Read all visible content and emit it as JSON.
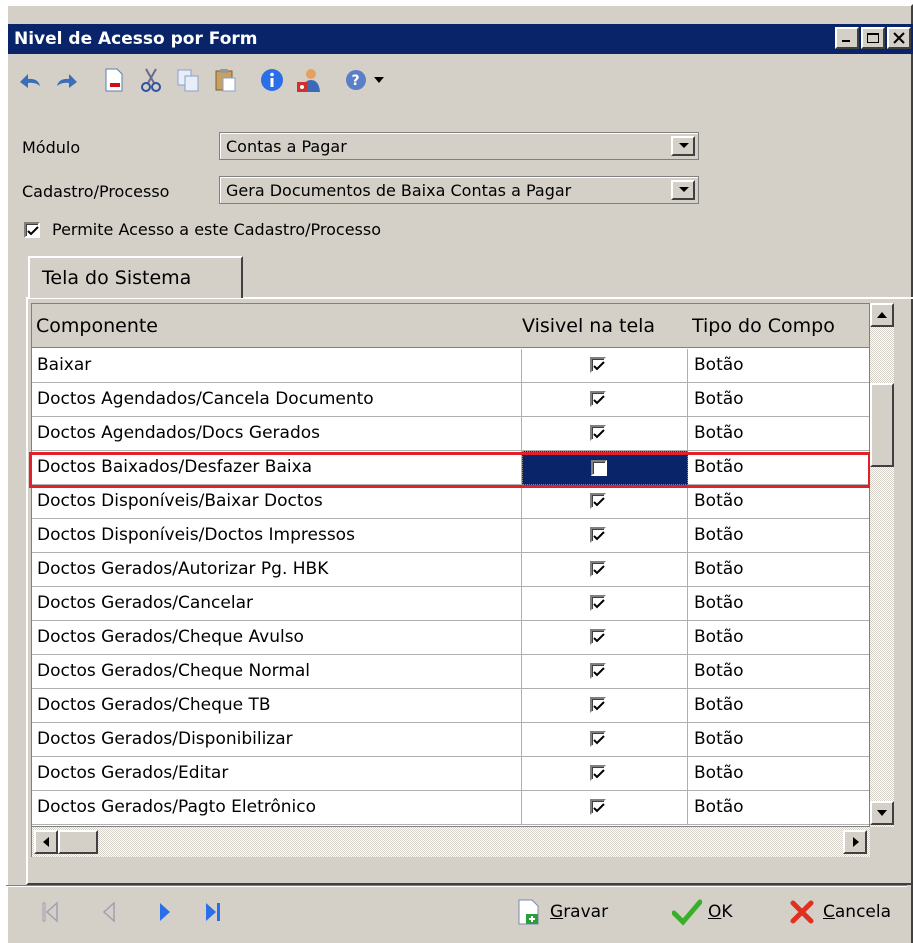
{
  "window": {
    "title": "Nivel de Acesso por Form"
  },
  "toolbar": {
    "items": [
      "undo-icon",
      "redo-icon",
      "new-document-icon",
      "cut-icon",
      "copy-icon",
      "paste-icon",
      "info-icon",
      "user-access-icon",
      "help-icon",
      "dropdown-arrow-icon"
    ]
  },
  "form": {
    "modulo_label": "Módulo",
    "modulo_value": "Contas a Pagar",
    "cadastro_label": "Cadastro/Processo",
    "cadastro_value": "Gera Documentos de Baixa Contas a Pagar",
    "permite_label": "Permite Acesso a este Cadastro/Processo",
    "permite_checked": true
  },
  "tab": {
    "label": "Tela do Sistema"
  },
  "grid": {
    "headers": {
      "componente": "Componente",
      "visivel": "Visivel na tela",
      "tipo": "Tipo do Compo"
    },
    "rows": [
      {
        "componente": "Baixar",
        "visivel": true,
        "tipo": "Botão"
      },
      {
        "componente": "Doctos Agendados/Cancela Documento",
        "visivel": true,
        "tipo": "Botão"
      },
      {
        "componente": "Doctos Agendados/Docs Gerados",
        "visivel": true,
        "tipo": "Botão"
      },
      {
        "componente": "Doctos Baixados/Desfazer Baixa",
        "visivel": false,
        "tipo": "Botão",
        "selected": true
      },
      {
        "componente": "Doctos Disponíveis/Baixar Doctos",
        "visivel": true,
        "tipo": "Botão"
      },
      {
        "componente": "Doctos Disponíveis/Doctos Impressos",
        "visivel": true,
        "tipo": "Botão"
      },
      {
        "componente": "Doctos Gerados/Autorizar Pg. HBK",
        "visivel": true,
        "tipo": "Botão"
      },
      {
        "componente": "Doctos Gerados/Cancelar",
        "visivel": true,
        "tipo": "Botão"
      },
      {
        "componente": "Doctos Gerados/Cheque Avulso",
        "visivel": true,
        "tipo": "Botão"
      },
      {
        "componente": "Doctos Gerados/Cheque Normal",
        "visivel": true,
        "tipo": "Botão"
      },
      {
        "componente": "Doctos Gerados/Cheque TB",
        "visivel": true,
        "tipo": "Botão"
      },
      {
        "componente": "Doctos Gerados/Disponibilizar",
        "visivel": true,
        "tipo": "Botão"
      },
      {
        "componente": "Doctos Gerados/Editar",
        "visivel": true,
        "tipo": "Botão"
      },
      {
        "componente": "Doctos Gerados/Pagto Eletrônico",
        "visivel": true,
        "tipo": "Botão"
      }
    ]
  },
  "footer": {
    "gravar_label": "Gravar",
    "ok_label": "OK",
    "cancela_label": "Cancela"
  },
  "colors": {
    "titlebar": "#0a246a",
    "selection": "#0a246a",
    "highlight": "#e0202a"
  }
}
